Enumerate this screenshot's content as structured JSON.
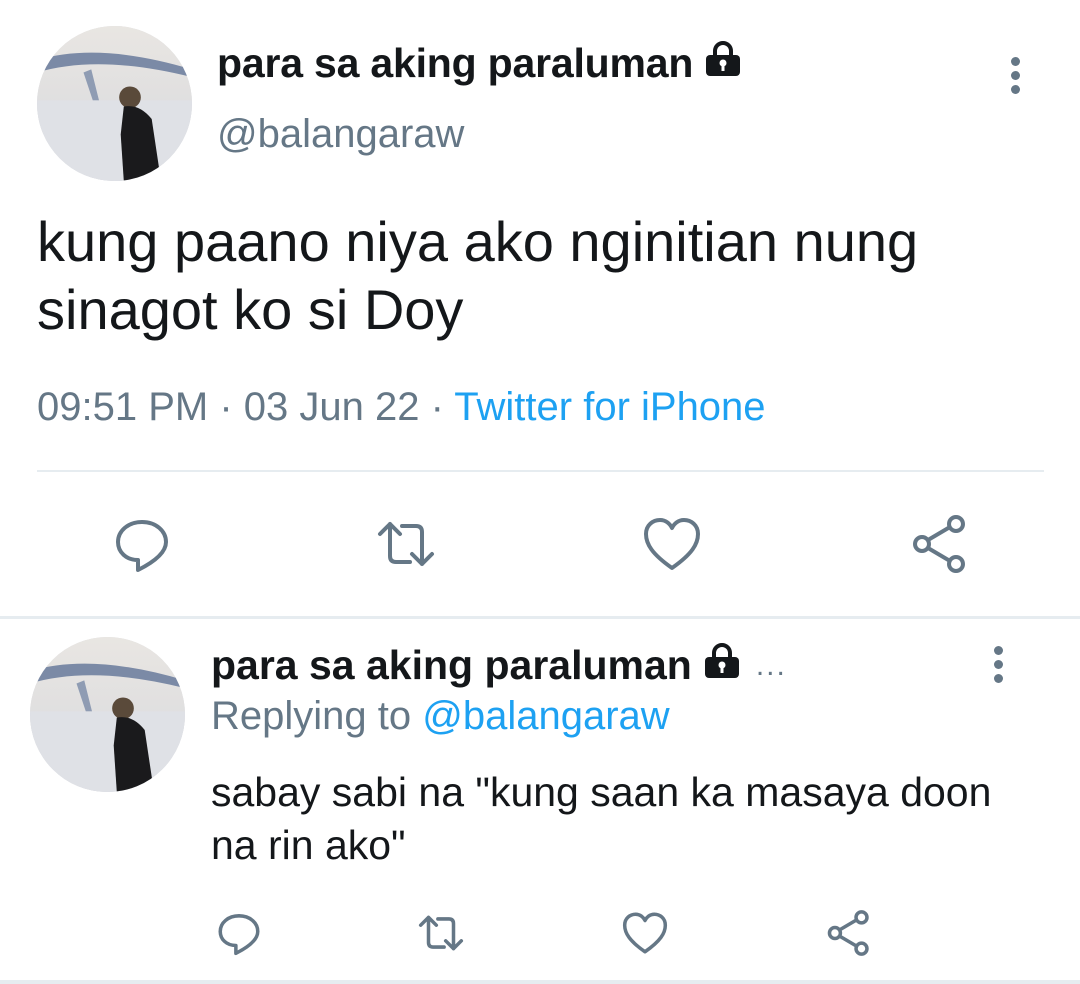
{
  "tweet": {
    "author_name": "para sa aking paraluman",
    "author_handle": "@balangaraw",
    "protected_icon": "lock-icon",
    "text": "kung paano niya ako nginitian nung sinagot ko si Doy",
    "time": "09:51 PM",
    "separator": " · ",
    "date": "03 Jun 22",
    "source": "Twitter for iPhone",
    "actions": [
      "reply-icon",
      "retweet-icon",
      "like-icon",
      "share-icon"
    ]
  },
  "reply": {
    "author_name": "para sa aking paraluman",
    "protected_icon": "lock-icon",
    "truncation": "...",
    "replying_label": "Replying to",
    "replying_to": "@balangaraw",
    "text": "sabay sabi na \"kung saan ka masaya doon na rin ako\"",
    "actions": [
      "reply-icon",
      "retweet-icon",
      "like-icon",
      "share-icon"
    ]
  },
  "colors": {
    "text": "#14171a",
    "secondary": "#657786",
    "accent": "#1da1f2",
    "divider": "#e6ecf0"
  }
}
